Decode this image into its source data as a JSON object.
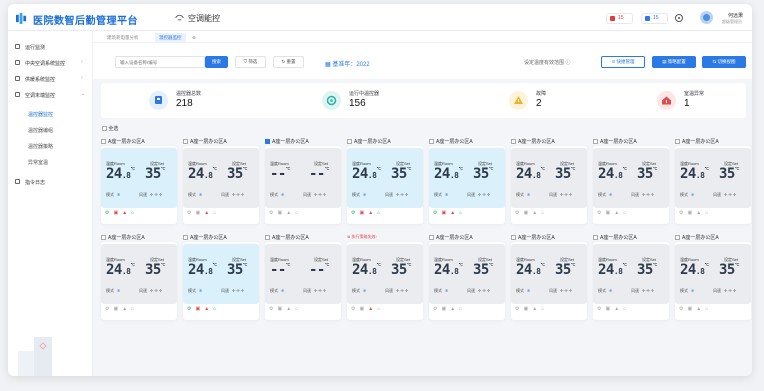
{
  "header": {
    "app_title": "医院数智后勤管理平台",
    "module_title": "空调能控",
    "alarm_red_count": "15",
    "alarm_blue_count": "15",
    "user_name": "何远秉",
    "user_role": "超级管理员"
  },
  "sidebar": {
    "items": [
      {
        "label": "运行监测"
      },
      {
        "label": "中央空调系统监控",
        "arrow": "›"
      },
      {
        "label": "供暖系统监控",
        "arrow": "›"
      },
      {
        "label": "空调末端监控",
        "arrow": "⌄"
      },
      {
        "label": "指令日志"
      }
    ],
    "sub_items": [
      {
        "label": "温控器监控",
        "active": true
      },
      {
        "label": "温控器编组"
      },
      {
        "label": "温控器策略"
      },
      {
        "label": "异常室温"
      }
    ]
  },
  "tabs": [
    {
      "label": "建筑耗电量分析"
    },
    {
      "label": "温控器监控",
      "close": "⊗"
    }
  ],
  "toolbar": {
    "search_placeholder": "输入设备名称/编号",
    "search_label": "搜索",
    "filter_label": "筛选",
    "reset_label": "重置",
    "year_label": "基准年：2022",
    "hint": "设定温度有效范围",
    "quick_label": "快捷管理",
    "policy_label": "策略配置",
    "switch_label": "切换视图"
  },
  "stats": [
    {
      "label": "温控器总数",
      "value": "218",
      "color": "#2a79e4"
    },
    {
      "label": "运行中温控器",
      "value": "156",
      "color": "#27b2a3"
    },
    {
      "label": "故障",
      "value": "2",
      "color": "#f0b323"
    },
    {
      "label": "室温异常",
      "value": "1",
      "color": "#e34a4a"
    }
  ],
  "select_all": "全选",
  "labels": {
    "room": "温度Room",
    "set": "设定Set",
    "mode": "模式",
    "fan": "风速",
    "unit": "℃"
  },
  "cards": [
    {
      "name": "A座一层办公区A",
      "on": true,
      "room_int": "24",
      "room_frac": ".8",
      "set": "35",
      "checked": false,
      "icons": [
        "green",
        "red",
        "red",
        "green"
      ]
    },
    {
      "name": "A座一层办公区A",
      "on": false,
      "room_int": "24",
      "room_frac": ".8",
      "set": "35",
      "checked": false,
      "icons": [
        "grey",
        "grey",
        "red",
        "grey"
      ]
    },
    {
      "name": "A座一层办公区A",
      "on": false,
      "room_int": "--",
      "room_frac": "",
      "set": "--",
      "checked": true,
      "icons": [
        "grey",
        "grey",
        "grey",
        "grey"
      ]
    },
    {
      "name": "A座一层办公区A",
      "on": true,
      "room_int": "24",
      "room_frac": ".8",
      "set": "35",
      "checked": false,
      "icons": [
        "green",
        "red",
        "red",
        "green"
      ]
    },
    {
      "name": "A座一层办公区A",
      "on": true,
      "room_int": "24",
      "room_frac": ".8",
      "set": "35",
      "checked": false,
      "icons": [
        "green",
        "red",
        "red",
        "green"
      ]
    },
    {
      "name": "A座一层办公区A",
      "on": false,
      "room_int": "24",
      "room_frac": ".8",
      "set": "35",
      "checked": false,
      "icons": [
        "grey",
        "grey",
        "grey",
        "grey"
      ]
    },
    {
      "name": "A座一层办公区A",
      "on": false,
      "room_int": "24",
      "room_frac": ".8",
      "set": "35",
      "checked": false,
      "icons": [
        "grey",
        "grey",
        "grey",
        "grey"
      ]
    },
    {
      "name": "A座一层办公区A",
      "on": false,
      "room_int": "24",
      "room_frac": ".8",
      "set": "35",
      "checked": false,
      "icons": [
        "grey",
        "grey",
        "grey",
        "grey"
      ]
    },
    {
      "name": "A座一层办公区A",
      "on": false,
      "room_int": "24",
      "room_frac": ".8",
      "set": "35",
      "checked": false,
      "icons": [
        "grey",
        "grey",
        "grey",
        "grey"
      ]
    },
    {
      "name": "A座一层办公区A",
      "on": true,
      "room_int": "24",
      "room_frac": ".8",
      "set": "35",
      "checked": false,
      "icons": [
        "green",
        "red",
        "red",
        "green"
      ]
    },
    {
      "name": "A座一层办公区A",
      "on": false,
      "room_int": "--",
      "room_frac": "",
      "set": "--",
      "checked": false,
      "icons": [
        "grey",
        "grey",
        "grey",
        "grey"
      ]
    },
    {
      "name": "A座一层办公区A",
      "on": false,
      "room_int": "24",
      "room_frac": ".8",
      "set": "35",
      "checked": false,
      "tag": "⊗ 执行策略失效!",
      "icons": [
        "grey",
        "grey",
        "red",
        "grey"
      ]
    },
    {
      "name": "A座一层办公区A",
      "on": false,
      "room_int": "24",
      "room_frac": ".8",
      "set": "35",
      "checked": false,
      "icons": [
        "grey",
        "grey",
        "grey",
        "grey"
      ]
    },
    {
      "name": "A座一层办公区A",
      "on": false,
      "room_int": "24",
      "room_frac": ".8",
      "set": "35",
      "checked": false,
      "icons": [
        "grey",
        "grey",
        "grey",
        "grey"
      ]
    },
    {
      "name": "A座一层办公区A",
      "on": false,
      "room_int": "24",
      "room_frac": ".8",
      "set": "35",
      "checked": false,
      "icons": [
        "grey",
        "grey",
        "grey",
        "grey"
      ]
    },
    {
      "name": "A座一层办公区A",
      "on": false,
      "room_int": "24",
      "room_frac": ".8",
      "set": "35",
      "checked": false,
      "icons": [
        "grey",
        "grey",
        "grey",
        "grey"
      ]
    }
  ]
}
